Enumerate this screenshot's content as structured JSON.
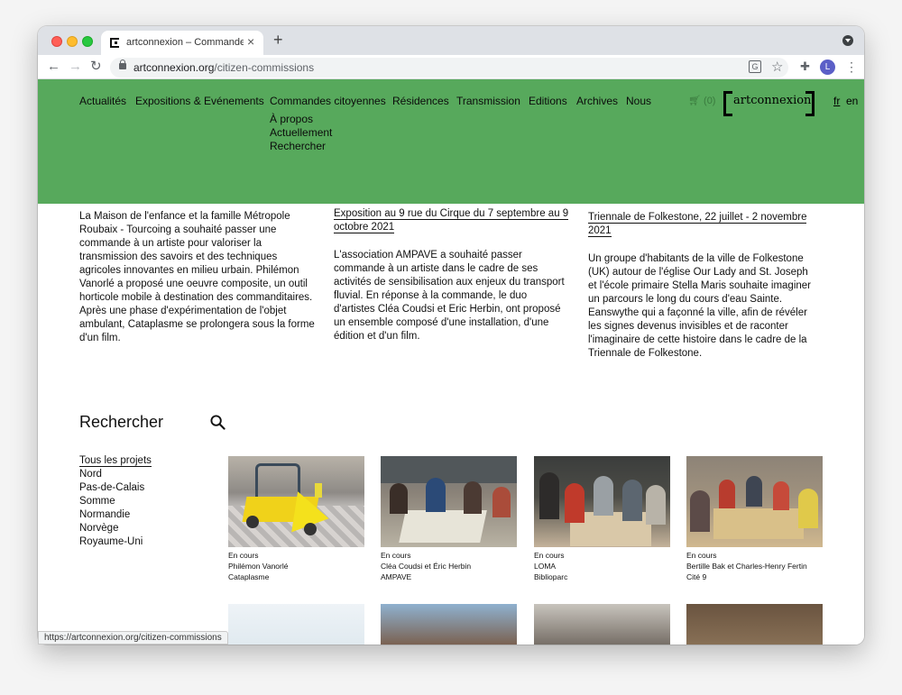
{
  "browser": {
    "tab_title": "artconnexion – Commandes citoyennes",
    "url_domain": "artconnexion.org",
    "url_path": "/citizen-commissions",
    "avatar_initial": "L",
    "status_url": "https://artconnexion.org/citizen-commissions"
  },
  "header": {
    "bg_color": "#57a95c",
    "nav": [
      "Actualités",
      "Expositions & Evénements",
      "Commandes citoyennes",
      "Résidences",
      "Transmission",
      "Editions",
      "Archives",
      "Nous"
    ],
    "subnav": [
      "À propos",
      "Actuellement",
      "Rechercher"
    ],
    "cart": "(0)",
    "logo": "artconnexion",
    "lang_fr": "fr",
    "lang_en": "en"
  },
  "columns": [
    {
      "heading": "",
      "body": "La Maison de l'enfance et la famille Métropole Roubaix - Tourcoing a souhaité passer une commande à un artiste pour valoriser la transmission des savoirs et des techniques agricoles innovantes en milieu urbain. Philémon Vanorlé a proposé une oeuvre composite, un outil horticole mobile à destination des commanditaires. Après une phase d'expérimentation de l'objet ambulant, Cataplasme se prolongera sous la forme d'un film."
    },
    {
      "heading": "Exposition au 9 rue du Cirque du 7 septembre au 9 octobre 2021",
      "body": "L'association AMPAVE a souhaité passer commande à un artiste dans le cadre de ses activités de sensibilisation aux enjeux du transport fluvial. En réponse à la commande, le duo d'artistes Cléa Coudsi et Eric Herbin, ont proposé un ensemble composé d'une installation, d'une édition et d'un film."
    },
    {
      "heading": "Triennale de Folkestone, 22 juillet - 2 novembre 2021",
      "body": "Un groupe d'habitants de la ville de Folkestone (UK) autour de l'église Our Lady and St. Joseph et l'école primaire Stella Maris souhaite imaginer un parcours le long du cours d'eau Sainte. Eanswythe qui a façonné la ville, afin de révéler les signes devenus invisibles et de raconter l'imaginaire de cette histoire dans le cadre de la Triennale de Folkestone."
    }
  ],
  "search": {
    "title": "Rechercher",
    "filters": [
      "Tous les projets",
      "Nord",
      "Pas-de-Calais",
      "Somme",
      "Normandie",
      "Norvège",
      "Royaume-Uni"
    ]
  },
  "projects": [
    {
      "status": "En cours",
      "artist": "Philémon Vanorlé",
      "title": "Cataplasme"
    },
    {
      "status": "En cours",
      "artist": "Cléa Coudsi et Éric Herbin",
      "title": "AMPAVE"
    },
    {
      "status": "En cours",
      "artist": "LOMA",
      "title": "Biblioparc"
    },
    {
      "status": "En cours",
      "artist": "Bertille Bak et Charles-Henry Fertin",
      "title": "Cité 9"
    }
  ]
}
